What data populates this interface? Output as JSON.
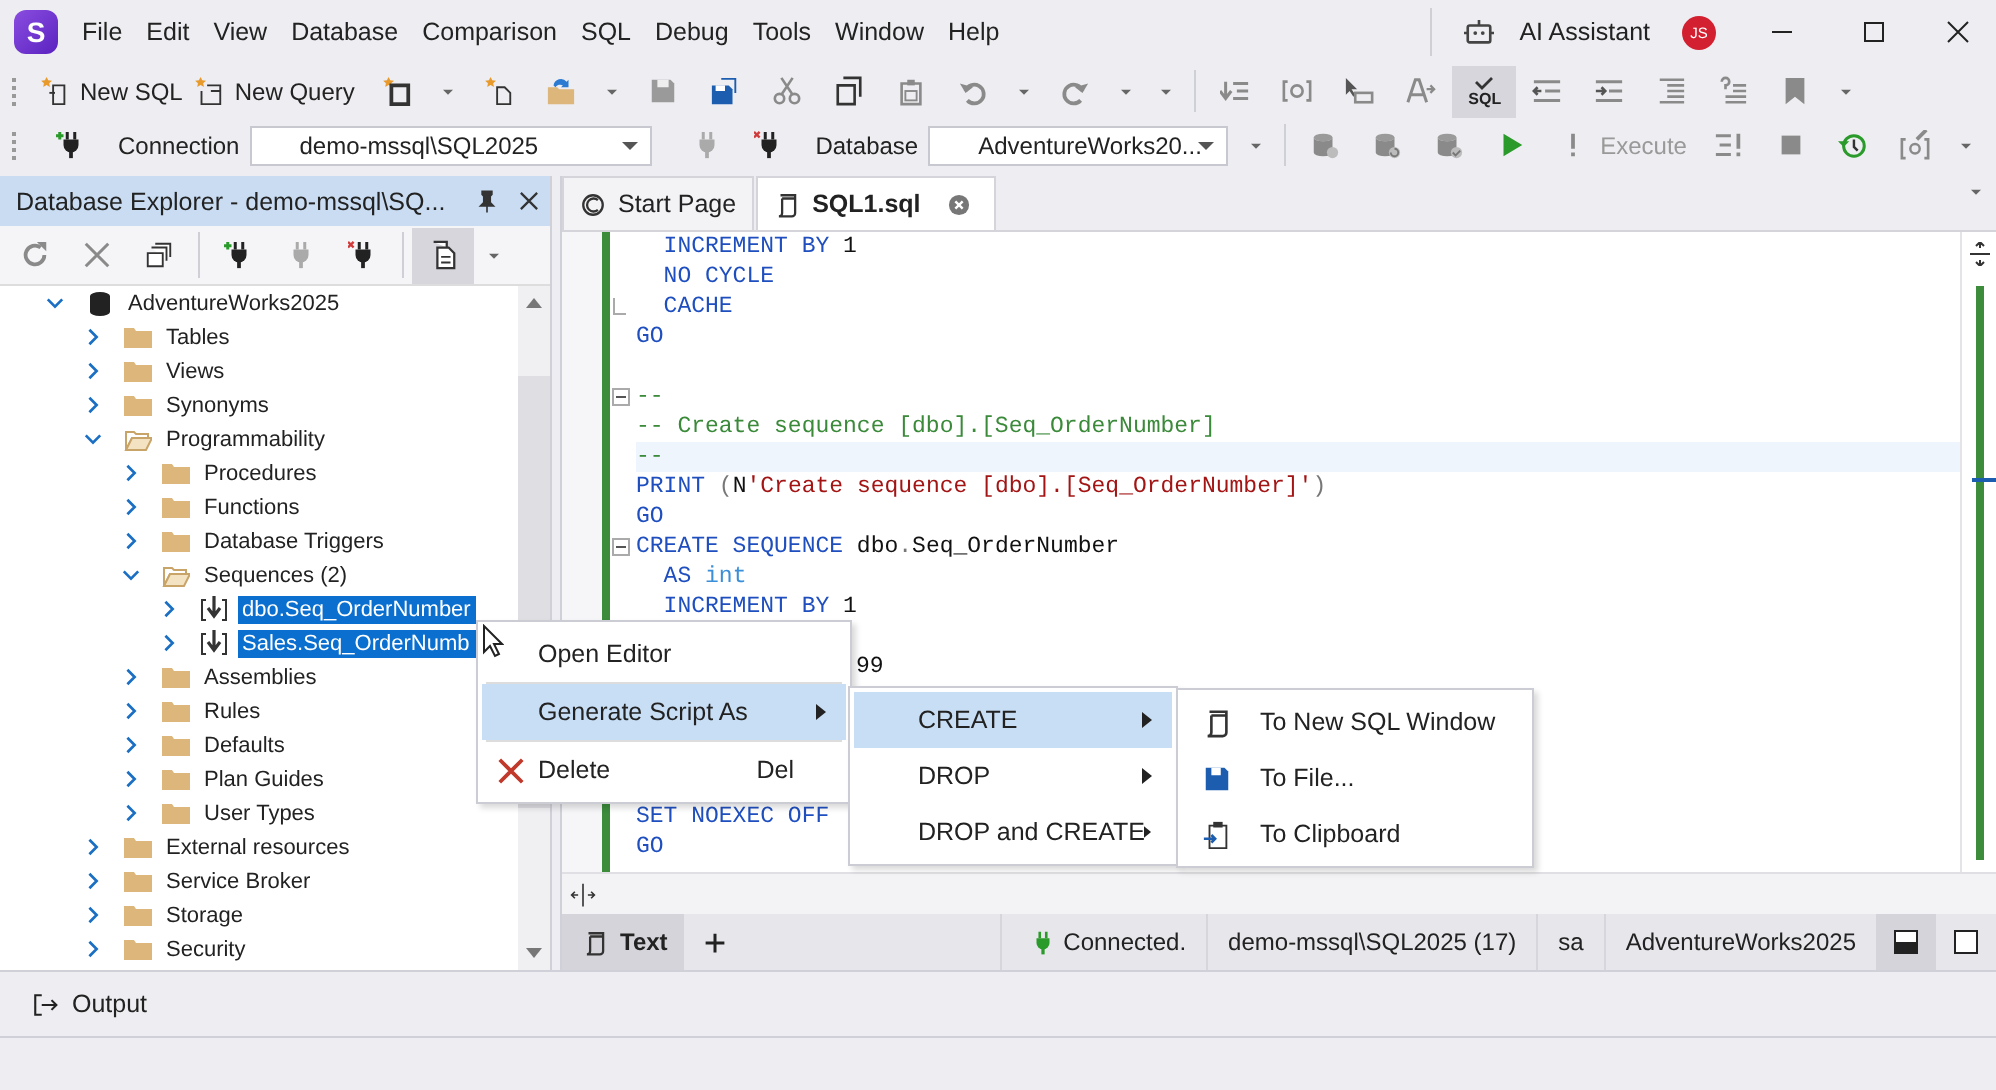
{
  "window": {
    "logo": "S",
    "menu": [
      "File",
      "Edit",
      "View",
      "Database",
      "Comparison",
      "SQL",
      "Debug",
      "Tools",
      "Window",
      "Help"
    ],
    "ai_assistant": "AI Assistant",
    "avatar": "JS"
  },
  "toolbar": {
    "new_sql": "New SQL",
    "new_query": "New Query",
    "sql_check": {
      "label": "SQL",
      "pressed": true
    },
    "connection_label": "Connection",
    "connection": "demo-mssql\\SQL2025",
    "database_label": "Database",
    "database": "AdventureWorks20...",
    "execute": "Execute",
    "execute_disabled": true
  },
  "explorer": {
    "title": "Database Explorer - demo-mssql\\SQ...",
    "tree": [
      {
        "label": "AdventureWorks2025",
        "kind": "database",
        "expanded": true,
        "selected": false,
        "children": [
          {
            "label": "Tables",
            "kind": "folder",
            "expanded": false,
            "selected": false
          },
          {
            "label": "Views",
            "kind": "folder",
            "expanded": false,
            "selected": false
          },
          {
            "label": "Synonyms",
            "kind": "folder",
            "expanded": false,
            "selected": false
          },
          {
            "label": "Programmability",
            "kind": "folder",
            "expanded": true,
            "selected": false,
            "children": [
              {
                "label": "Procedures",
                "kind": "folder",
                "expanded": false,
                "selected": false
              },
              {
                "label": "Functions",
                "kind": "folder",
                "expanded": false,
                "selected": false
              },
              {
                "label": "Database Triggers",
                "kind": "folder",
                "expanded": false,
                "selected": false
              },
              {
                "label": "Sequences (2)",
                "kind": "folder",
                "expanded": true,
                "selected": false,
                "children": [
                  {
                    "label": "dbo.Seq_OrderNumber",
                    "kind": "sequence",
                    "expanded": false,
                    "selected": true
                  },
                  {
                    "label": "Sales.Seq_OrderNumb",
                    "kind": "sequence",
                    "expanded": false,
                    "selected": true
                  }
                ]
              },
              {
                "label": "Assemblies",
                "kind": "folder",
                "expanded": false,
                "selected": false
              },
              {
                "label": "Rules",
                "kind": "folder",
                "expanded": false,
                "selected": false
              },
              {
                "label": "Defaults",
                "kind": "folder",
                "expanded": false,
                "selected": false
              },
              {
                "label": "Plan Guides",
                "kind": "folder",
                "expanded": false,
                "selected": false
              },
              {
                "label": "User Types",
                "kind": "folder",
                "expanded": false,
                "selected": false
              }
            ]
          },
          {
            "label": "External resources",
            "kind": "folder",
            "expanded": false,
            "selected": false
          },
          {
            "label": "Service Broker",
            "kind": "folder",
            "expanded": false,
            "selected": false
          },
          {
            "label": "Storage",
            "kind": "folder",
            "expanded": false,
            "selected": false
          },
          {
            "label": "Security",
            "kind": "folder",
            "expanded": false,
            "selected": false
          }
        ]
      }
    ]
  },
  "editor": {
    "tabs": [
      {
        "label": "Start Page",
        "kind": "start",
        "selected": false
      },
      {
        "label": "SQL1.sql",
        "kind": "sql",
        "selected": true
      }
    ],
    "lines": [
      {
        "kind": "code",
        "tokens": [
          {
            "text": "  INCREMENT BY ",
            "kind": "keyword"
          },
          {
            "text": "1",
            "kind": "plain"
          }
        ]
      },
      {
        "kind": "code",
        "tokens": [
          {
            "text": "  NO CYCLE",
            "kind": "keyword"
          }
        ]
      },
      {
        "kind": "code",
        "fold_end": true,
        "tokens": [
          {
            "text": "  CACHE",
            "kind": "keyword"
          }
        ]
      },
      {
        "kind": "code",
        "tokens": [
          {
            "text": "GO",
            "kind": "keyword"
          }
        ]
      },
      {
        "kind": "blank"
      },
      {
        "kind": "code",
        "fold_start": true,
        "tokens": [
          {
            "text": "--",
            "kind": "comment"
          }
        ]
      },
      {
        "kind": "code",
        "tokens": [
          {
            "text": "-- Create sequence [dbo].[Seq_OrderNumber]",
            "kind": "comment"
          }
        ]
      },
      {
        "kind": "code",
        "current": true,
        "tokens": [
          {
            "text": "--",
            "kind": "comment"
          }
        ]
      },
      {
        "kind": "code",
        "tokens": [
          {
            "text": "PRINT ",
            "kind": "keyword"
          },
          {
            "text": "(",
            "kind": "punctuation"
          },
          {
            "text": "N",
            "kind": "plain"
          },
          {
            "text": "'Create sequence [dbo].[Seq_OrderNumber]'",
            "kind": "string"
          },
          {
            "text": ")",
            "kind": "punctuation"
          }
        ]
      },
      {
        "kind": "code",
        "tokens": [
          {
            "text": "GO",
            "kind": "keyword"
          }
        ]
      },
      {
        "kind": "code",
        "fold_start": true,
        "tokens": [
          {
            "text": "CREATE SEQUENCE ",
            "kind": "keyword"
          },
          {
            "text": "dbo",
            "kind": "plain"
          },
          {
            "text": ".",
            "kind": "punctuation"
          },
          {
            "text": "Seq_OrderNumber",
            "kind": "plain"
          }
        ]
      },
      {
        "kind": "code",
        "tokens": [
          {
            "text": "  AS ",
            "kind": "keyword"
          },
          {
            "text": "int",
            "kind": "type"
          }
        ]
      },
      {
        "kind": "code",
        "tokens": [
          {
            "text": "  INCREMENT BY ",
            "kind": "keyword"
          },
          {
            "text": "1",
            "kind": "plain"
          }
        ]
      },
      {
        "kind": "covered"
      },
      {
        "kind": "partly_covered",
        "tokens": [
          {
            "text": "99",
            "kind": "plain"
          }
        ]
      },
      {
        "kind": "covered"
      },
      {
        "kind": "covered"
      },
      {
        "kind": "covered"
      },
      {
        "kind": "covered"
      },
      {
        "kind": "code",
        "tokens": [
          {
            "text": "SET NOEXEC OFF",
            "kind": "keyword"
          }
        ]
      },
      {
        "kind": "code",
        "tokens": [
          {
            "text": "GO",
            "kind": "keyword"
          }
        ]
      }
    ]
  },
  "context_menu": {
    "items": [
      {
        "label": "Open Editor",
        "kind": "plain",
        "selected": false
      },
      {
        "label": "Generate Script As",
        "kind": "submenu",
        "selected": true
      },
      {
        "label": "Delete",
        "kind": "delete",
        "shortcut": "Del",
        "selected": false
      }
    ]
  },
  "script_menu": {
    "items": [
      {
        "label": "CREATE",
        "selected": true
      },
      {
        "label": "DROP",
        "selected": false
      },
      {
        "label": "DROP and CREATE",
        "selected": false
      }
    ]
  },
  "target_menu": {
    "items": [
      {
        "label": "To New SQL Window",
        "kind": "sql-window",
        "selected": false
      },
      {
        "label": "To File...",
        "kind": "file",
        "selected": false
      },
      {
        "label": "To Clipboard",
        "kind": "clipboard",
        "selected": false
      }
    ]
  },
  "status_bar": {
    "views": [
      {
        "label": "Text",
        "selected": true
      }
    ],
    "connection_status": "Connected.",
    "server": "demo-mssql\\SQL2025 (17)",
    "user": "sa",
    "database": "AdventureWorks2025"
  },
  "output": {
    "label": "Output"
  }
}
